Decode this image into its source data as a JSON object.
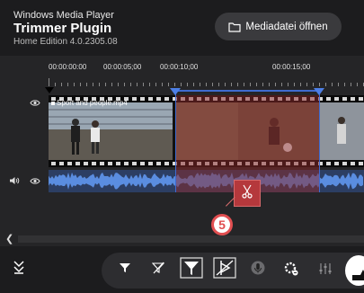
{
  "header": {
    "app_name": "Windows Media Player",
    "title": "Trimmer Plugin",
    "version": "Home Edition 4.0.2305.08",
    "open_button_label": "Mediadatei öffnen"
  },
  "timeline": {
    "time_labels": [
      "00:00:00:00",
      "00:00:05;00",
      "00:00:10;00",
      "00:00:15;00"
    ],
    "clip_label": "Sport and people.mp4"
  },
  "callout": {
    "number": "5"
  },
  "icons": {
    "open": "folder-icon",
    "cut": "scissors-icon",
    "visibility": "eye-icon",
    "audio": "speaker-icon",
    "collapse": "double-chevron-down-icon",
    "mark_in": "marker-in-icon",
    "mark_out": "marker-out-icon",
    "filter": "filter-icon",
    "no_filter": "filter-off-icon",
    "mic": "microphone-icon",
    "settings": "gear-icon",
    "mixer": "sliders-icon"
  },
  "colors": {
    "background": "#1c1c1e",
    "selection": "#8c2828",
    "selection_edge": "#3e6bd0",
    "cut_button": "#b5383c",
    "callout": "#e14f51",
    "waveform": "#5a8de0"
  }
}
